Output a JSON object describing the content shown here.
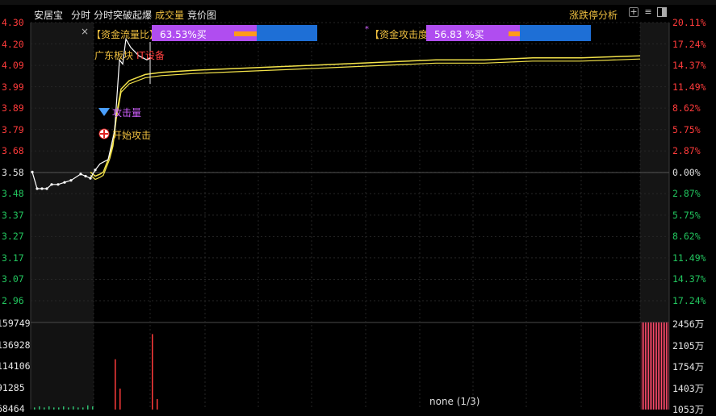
{
  "header": {
    "stock_name": "安居宝",
    "tab_intraday": "分时",
    "tab_breakout": "分时突破起爆",
    "tab_volume": "成交量",
    "tab_auction": "竞价图",
    "tab_limit_analysis": "涨跌停分析",
    "icons": [
      "add-icon",
      "menu-icon",
      "split-icon"
    ]
  },
  "colors": {
    "up": "#ff3b3b",
    "down": "#22c55e",
    "price_line": "#ffffff",
    "avg_line": "#f2e24a",
    "magenta_bar": "#b04df0",
    "blue_bar": "#1e6fd6",
    "orange_bar": "#ff9a1a"
  },
  "axes": {
    "price_ticks": [
      "4.30",
      "4.20",
      "4.09",
      "3.99",
      "3.89",
      "3.79",
      "3.68",
      "3.58",
      "3.48",
      "3.37",
      "3.27",
      "3.17",
      "3.07",
      "2.96"
    ],
    "pct_ticks": [
      "20.11%",
      "17.24%",
      "14.37%",
      "11.49%",
      "8.62%",
      "5.75%",
      "2.87%",
      "0.00%",
      "2.87%",
      "5.75%",
      "8.62%",
      "11.49%",
      "14.37%",
      "17.24%"
    ],
    "pct_signs": [
      "up",
      "up",
      "up",
      "up",
      "up",
      "up",
      "up",
      "flat",
      "down",
      "down",
      "down",
      "down",
      "down",
      "down"
    ],
    "volume_left": [
      "159749",
      "136928",
      "114106",
      "91285",
      "68464"
    ],
    "volume_right": [
      "2456万",
      "2105万",
      "1754万",
      "1403万",
      "1053万"
    ]
  },
  "panels": {
    "fund_flow": {
      "label": "【资金流量比】",
      "value": "63.53%买",
      "close_icon": "×",
      "fill_fraction": 0.2
    },
    "fund_attack": {
      "label": "【资金攻击度】",
      "value": "56.83 %买",
      "marker": "*",
      "fill_fraction": 0.16
    }
  },
  "annotations": {
    "sector": "广东板块",
    "industry": "IT设备",
    "attack_volume": "攻击量",
    "start_attack": "开始攻击"
  },
  "footer": {
    "pager": "none (1/3)"
  },
  "chart_data": {
    "type": "line",
    "base_price": 3.58,
    "ylim": [
      2.96,
      4.3
    ],
    "series": [
      {
        "values": [
          3.58,
          3.5,
          3.5,
          3.5,
          3.52,
          3.52,
          3.53,
          3.54,
          3.57,
          3.56,
          3.55,
          3.59,
          3.62,
          3.64,
          3.78,
          4.12,
          4.1,
          4.22,
          4.18,
          4.14,
          4.12,
          4.13
        ]
      },
      {
        "values": [
          3.58,
          3.56,
          3.57,
          3.58,
          3.62,
          3.66,
          3.72,
          3.85,
          3.98,
          4.02,
          4.05,
          4.06,
          4.07,
          4.08,
          4.09,
          4.1,
          4.11,
          4.12,
          4.12,
          4.13,
          4.13,
          4.14
        ]
      }
    ],
    "volume": {
      "ylim_left": [
        68464,
        159749
      ],
      "bars": [
        2,
        3,
        2,
        3,
        2,
        2,
        3,
        2,
        3,
        2,
        2,
        4,
        3,
        48,
        20,
        72,
        10
      ]
    }
  }
}
